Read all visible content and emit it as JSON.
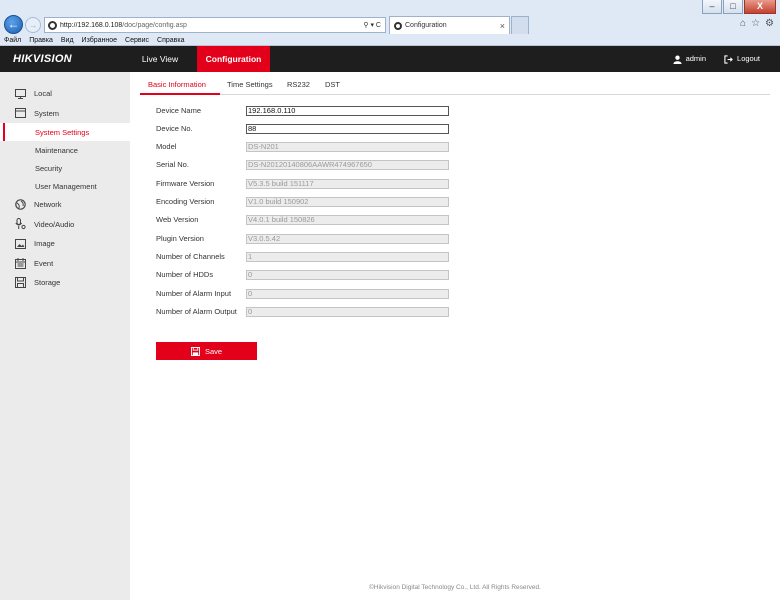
{
  "browser": {
    "url_host": "http://192.168.0.108",
    "url_path": "/doc/page/config.asp",
    "address_icons": "⚲ ▾ C",
    "tab_title": "Configuration",
    "tab_close": "×",
    "menu": [
      "Файл",
      "Правка",
      "Вид",
      "Избранное",
      "Сервис",
      "Справка"
    ],
    "win_minimize": "–",
    "win_maximize": "□",
    "win_close": "X",
    "back_glyph": "←",
    "forward_glyph": "→",
    "right_icons": [
      "⌂",
      "☆",
      "⚙"
    ]
  },
  "header": {
    "logo": "HIKVISION",
    "tabs": {
      "live_view": "Live View",
      "configuration": "Configuration"
    },
    "user": "admin",
    "logout": "Logout"
  },
  "sidebar": {
    "local": "Local",
    "system": "System",
    "system_settings": "System Settings",
    "maintenance": "Maintenance",
    "security": "Security",
    "user_management": "User Management",
    "network": "Network",
    "video_audio": "Video/Audio",
    "image": "Image",
    "event": "Event",
    "storage": "Storage"
  },
  "subtabs": {
    "basic": "Basic Information",
    "time": "Time Settings",
    "rs232": "RS232",
    "dst": "DST"
  },
  "form": {
    "device_name": {
      "label": "Device Name",
      "value": "192.168.0.110"
    },
    "device_no": {
      "label": "Device No.",
      "value": "88"
    },
    "model": {
      "label": "Model",
      "value": "DS-N201"
    },
    "serial_no": {
      "label": "Serial No.",
      "value": "DS-N20120140806AAWR474967650"
    },
    "firmware_version": {
      "label": "Firmware Version",
      "value": "V5.3.5 build 151117"
    },
    "encoding_version": {
      "label": "Encoding Version",
      "value": "V1.0 build 150902"
    },
    "web_version": {
      "label": "Web Version",
      "value": "V4.0.1 build 150826"
    },
    "plugin_version": {
      "label": "Plugin Version",
      "value": "V3.0.5.42"
    },
    "num_channels": {
      "label": "Number of Channels",
      "value": "1"
    },
    "num_hdds": {
      "label": "Number of HDDs",
      "value": "0"
    },
    "num_alarm_input": {
      "label": "Number of Alarm Input",
      "value": "0"
    },
    "num_alarm_output": {
      "label": "Number of Alarm Output",
      "value": "0"
    }
  },
  "save_label": "Save",
  "footer": "©Hikvision Digital Technology Co., Ltd. All Rights Reserved.",
  "colors": {
    "accent": "#e3001b",
    "header_bg": "#1e1e1e",
    "sidebar_bg": "#ebebeb"
  },
  "icons": {
    "local": "monitor-icon",
    "system": "system-icon",
    "network": "globe-icon",
    "video_audio": "video-audio-icon",
    "image": "image-icon",
    "event": "calendar-icon",
    "storage": "disk-icon",
    "user": "user-icon",
    "logout": "logout-icon",
    "save": "save-icon"
  }
}
